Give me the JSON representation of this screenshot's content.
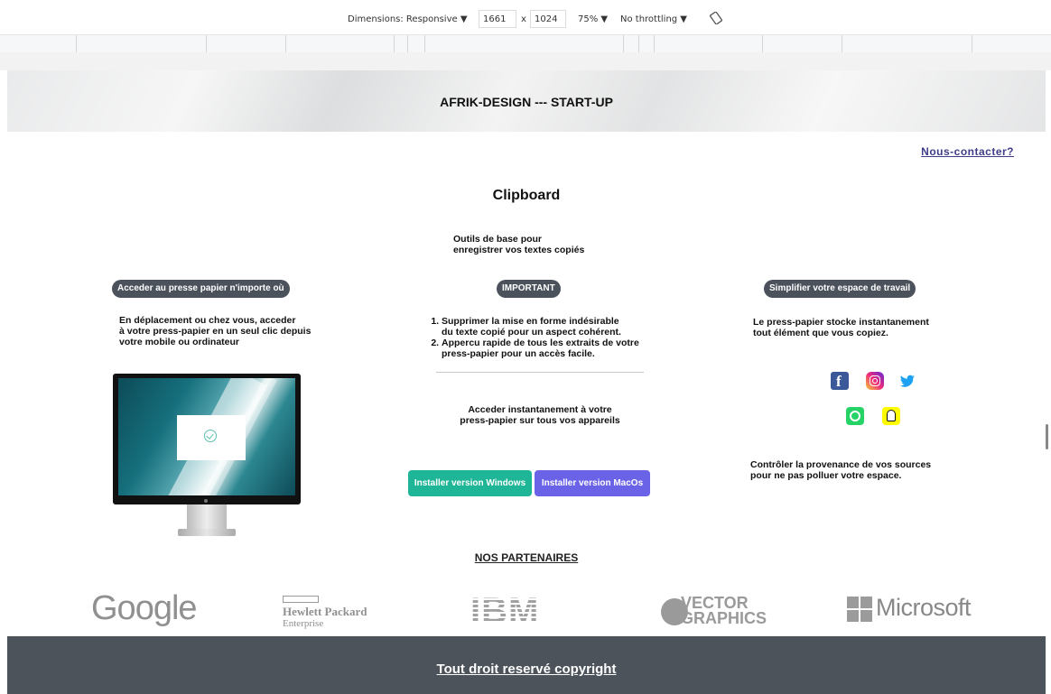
{
  "devtools": {
    "dimensions_label": "Dimensions: Responsive ▼",
    "width": "1661",
    "times": "x",
    "height": "1024",
    "zoom": "75% ▼",
    "throttling": "No throttling ▼",
    "rotate_icon": "rotate-device-icon"
  },
  "header": {
    "title": "AFRIK-DESIGN --- START-UP"
  },
  "contact": {
    "label": "Nous-contacter?"
  },
  "main": {
    "title": "Clipboard",
    "subtitle_line1": "Outils de base pour",
    "subtitle_line2": "enregistrer vos textes copiés"
  },
  "left": {
    "pill": "Acceder au presse papier n'importe où",
    "text_line1": "En déplacement ou chez vous, acceder",
    "text_line2": "à votre press-papier en un seul clic depuis",
    "text_line3": "votre mobile ou ordinateur"
  },
  "center": {
    "pill": "IMPORTANT",
    "list": [
      {
        "line1": "Supprimer la mise en forme indésirable",
        "line2": "du texte copié pour un aspect cohérent."
      },
      {
        "line1": "Appercu rapide de tous les extraits de votre",
        "line2": "press-papier pour un accès facile."
      }
    ],
    "instant_line1": "Acceder instantanement à votre",
    "instant_line2": "press-papier sur tous vos appareils",
    "btn_windows": "Installer version Windows",
    "btn_mac": "Installer version MacOs"
  },
  "right": {
    "pill": "Simplifier votre espace de travail",
    "text_line1": "Le press-papier stocke instantanement",
    "text_line2": "tout élément que vous copiez.",
    "bottom_line1": "Contrôler la provenance de vos sources",
    "bottom_line2": "pour ne pas polluer votre espace.",
    "social_icons": [
      "facebook-icon",
      "instagram-icon",
      "twitter-icon",
      "whatsapp-icon",
      "snapchat-icon"
    ]
  },
  "partners": {
    "title": "NOS PARTENAIRES",
    "google": "Google",
    "hp_line1": "Hewlett Packard",
    "hp_line2": "Enterprise",
    "ibm": "IBM",
    "vector_line1": "VECTOR",
    "vector_line2": "GRAPHICS",
    "microsoft": "Microsoft"
  },
  "footer": {
    "text": "Tout droit reservé copyright"
  },
  "colors": {
    "pill_bg": "#4b525c",
    "btn_windows": "#1fb597",
    "btn_mac": "#6b63e7",
    "contact_link": "#3f3d8a",
    "footer_bg": "#4c535b"
  }
}
